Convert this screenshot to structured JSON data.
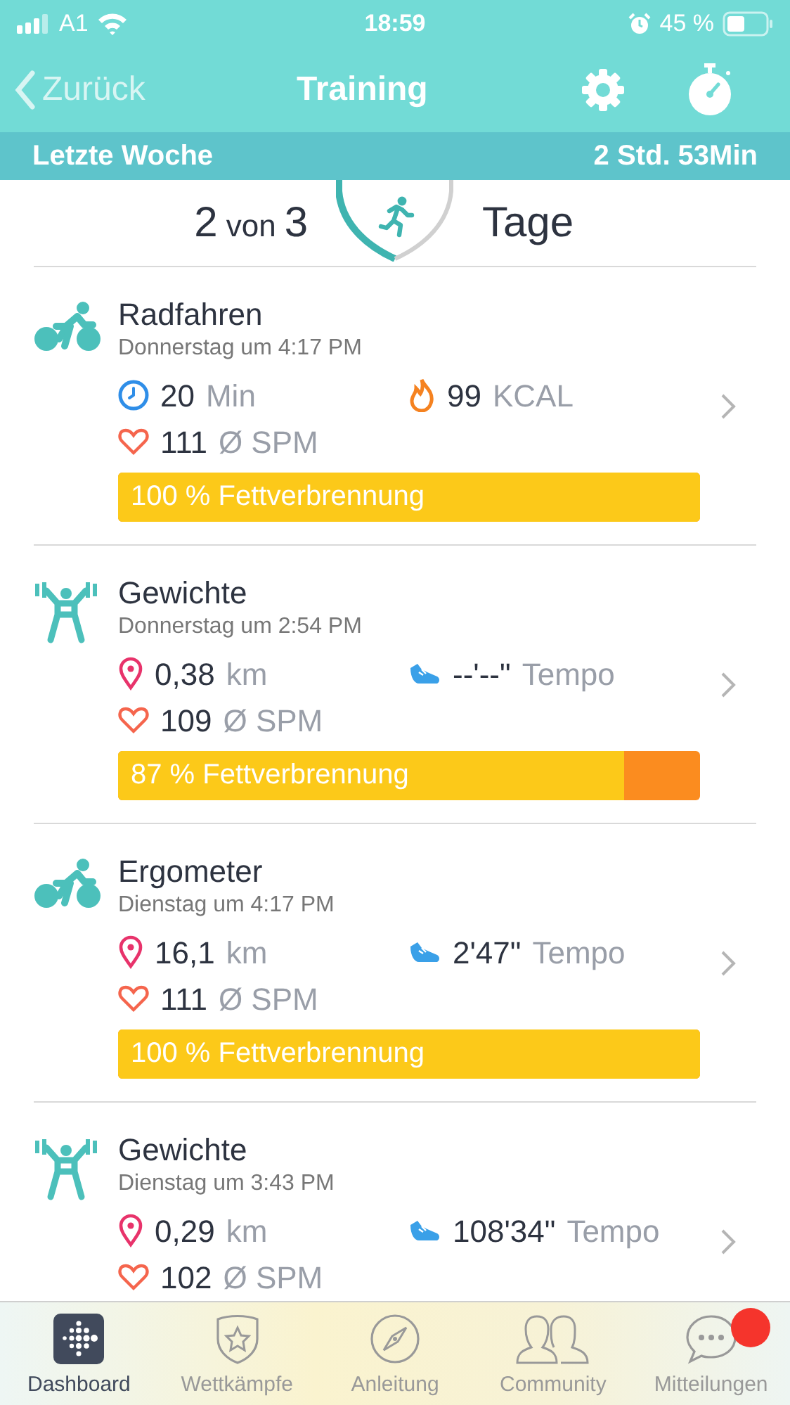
{
  "status_bar": {
    "carrier": "A1",
    "time": "18:59",
    "battery": "45 %"
  },
  "nav": {
    "back": "Zurück",
    "title": "Training"
  },
  "period": {
    "label": "Letzte Woche",
    "total": "2 Std. 53Min"
  },
  "summary": {
    "done": "2",
    "of": "von",
    "goal": "3",
    "unit": "Tage"
  },
  "entries": [
    {
      "kind": "bike",
      "name": "Radfahren",
      "time": "Donnerstag um 4:17 PM",
      "metrics": [
        {
          "kind": "duration",
          "value": "20",
          "unit": "Min"
        },
        {
          "kind": "calories",
          "value": "99",
          "unit": "KCAL"
        }
      ],
      "heart": {
        "value": "111",
        "unit": "Ø SPM"
      },
      "burn": {
        "text": "100 % Fettverbrennung",
        "level": 1
      }
    },
    {
      "kind": "weights",
      "name": "Gewichte",
      "time": "Donnerstag um 2:54 PM",
      "metrics": [
        {
          "kind": "distance",
          "value": "0,38",
          "unit": "km"
        },
        {
          "kind": "pace",
          "value": "--'--\"",
          "unit": "Tempo"
        }
      ],
      "heart": {
        "value": "109",
        "unit": "Ø SPM"
      },
      "burn": {
        "text": "87 % Fettverbrennung",
        "level": 0.87
      }
    },
    {
      "kind": "bike",
      "name": "Ergometer",
      "time": "Dienstag um 4:17 PM",
      "metrics": [
        {
          "kind": "distance",
          "value": "16,1",
          "unit": "km"
        },
        {
          "kind": "pace",
          "value": "2'47\"",
          "unit": "Tempo"
        }
      ],
      "heart": {
        "value": "111",
        "unit": "Ø SPM"
      },
      "burn": {
        "text": "100 % Fettverbrennung",
        "level": 1
      }
    },
    {
      "kind": "weights",
      "name": "Gewichte",
      "time": "Dienstag um 3:43 PM",
      "metrics": [
        {
          "kind": "distance",
          "value": "0,29",
          "unit": "km"
        },
        {
          "kind": "pace",
          "value": "108'34\"",
          "unit": "Tempo"
        }
      ],
      "heart": {
        "value": "102",
        "unit": "Ø SPM"
      }
    }
  ],
  "tabs": [
    {
      "kind": "dashboard",
      "label": "Dashboard",
      "selected": true,
      "badge": false
    },
    {
      "kind": "challenges",
      "label": "Wettkämpfe",
      "selected": false,
      "badge": false
    },
    {
      "kind": "guide",
      "label": "Anleitung",
      "selected": false,
      "badge": false
    },
    {
      "kind": "community",
      "label": "Community",
      "selected": false,
      "badge": false
    },
    {
      "kind": "messages",
      "label": "Mitteilungen",
      "selected": false,
      "badge": true
    }
  ]
}
